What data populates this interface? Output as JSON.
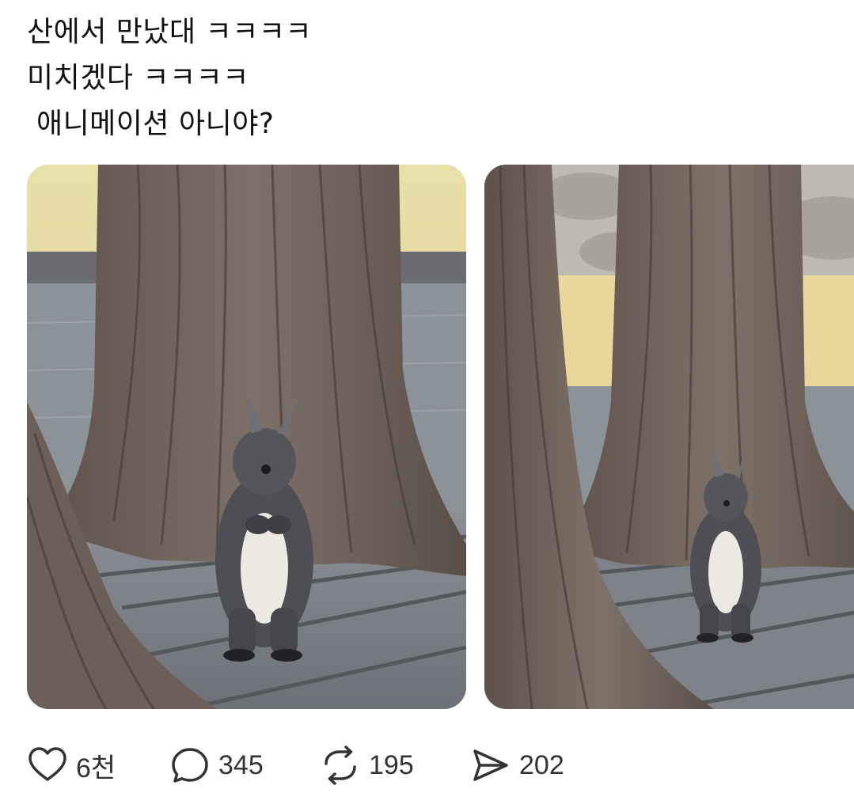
{
  "post": {
    "lines": [
      "산에서 만났대 ㅋㅋㅋㅋ",
      "미치겠다 ㅋㅋㅋㅋ",
      " 애니메이션 아니야?"
    ]
  },
  "media": {
    "images": [
      {
        "icon": "squirrel-photo-1"
      },
      {
        "icon": "squirrel-photo-2"
      }
    ]
  },
  "actions": {
    "like": {
      "icon": "heart-icon",
      "count": "6천"
    },
    "reply": {
      "icon": "speech-bubble-icon",
      "count": "345"
    },
    "repost": {
      "icon": "repost-icon",
      "count": "195"
    },
    "share": {
      "icon": "send-icon",
      "count": "202"
    }
  },
  "colors": {
    "text": "#111111",
    "icon": "#333333",
    "background": "#ffffff"
  }
}
